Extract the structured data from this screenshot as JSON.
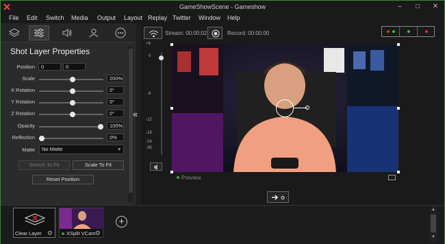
{
  "window": {
    "title": "GameShowScene - Gameshow"
  },
  "menu": [
    "File",
    "Edit",
    "Switch",
    "Media",
    "Output",
    "Layout",
    "Replay",
    "Twitter",
    "Window",
    "Help"
  ],
  "panel": {
    "title": "Shot Layer Properties",
    "position_label": "Position",
    "position_x": "0",
    "position_y": "0",
    "scale_label": "Scale",
    "scale_value": "200%",
    "xrot_label": "X Rotation",
    "xrot_value": "0°",
    "yrot_label": "Y Rotation",
    "yrot_value": "0°",
    "zrot_label": "Z Rotation",
    "zrot_value": "0°",
    "opacity_label": "Opacity",
    "opacity_value": "100%",
    "reflection_label": "Reflection",
    "reflection_value": "0%",
    "matte_label": "Matte",
    "matte_value": "No Matte",
    "stretch_button": "Stretch To Fit",
    "scale_button": "Scale To Fit",
    "reset_button": "Reset Position"
  },
  "stream": {
    "stream_label": "Stream: 00:00:02",
    "record_label": "Record: 00:00:00"
  },
  "audio_scale": [
    "+6",
    "0",
    "-6",
    "-12",
    "-18",
    "-24",
    "-36"
  ],
  "preview_label": "Preview",
  "scenes": [
    {
      "label": "Clear Layer"
    },
    {
      "label": "XSplit VCam"
    }
  ],
  "colors": {
    "accent": "#3aa63a",
    "background": "#1f1f1f"
  }
}
